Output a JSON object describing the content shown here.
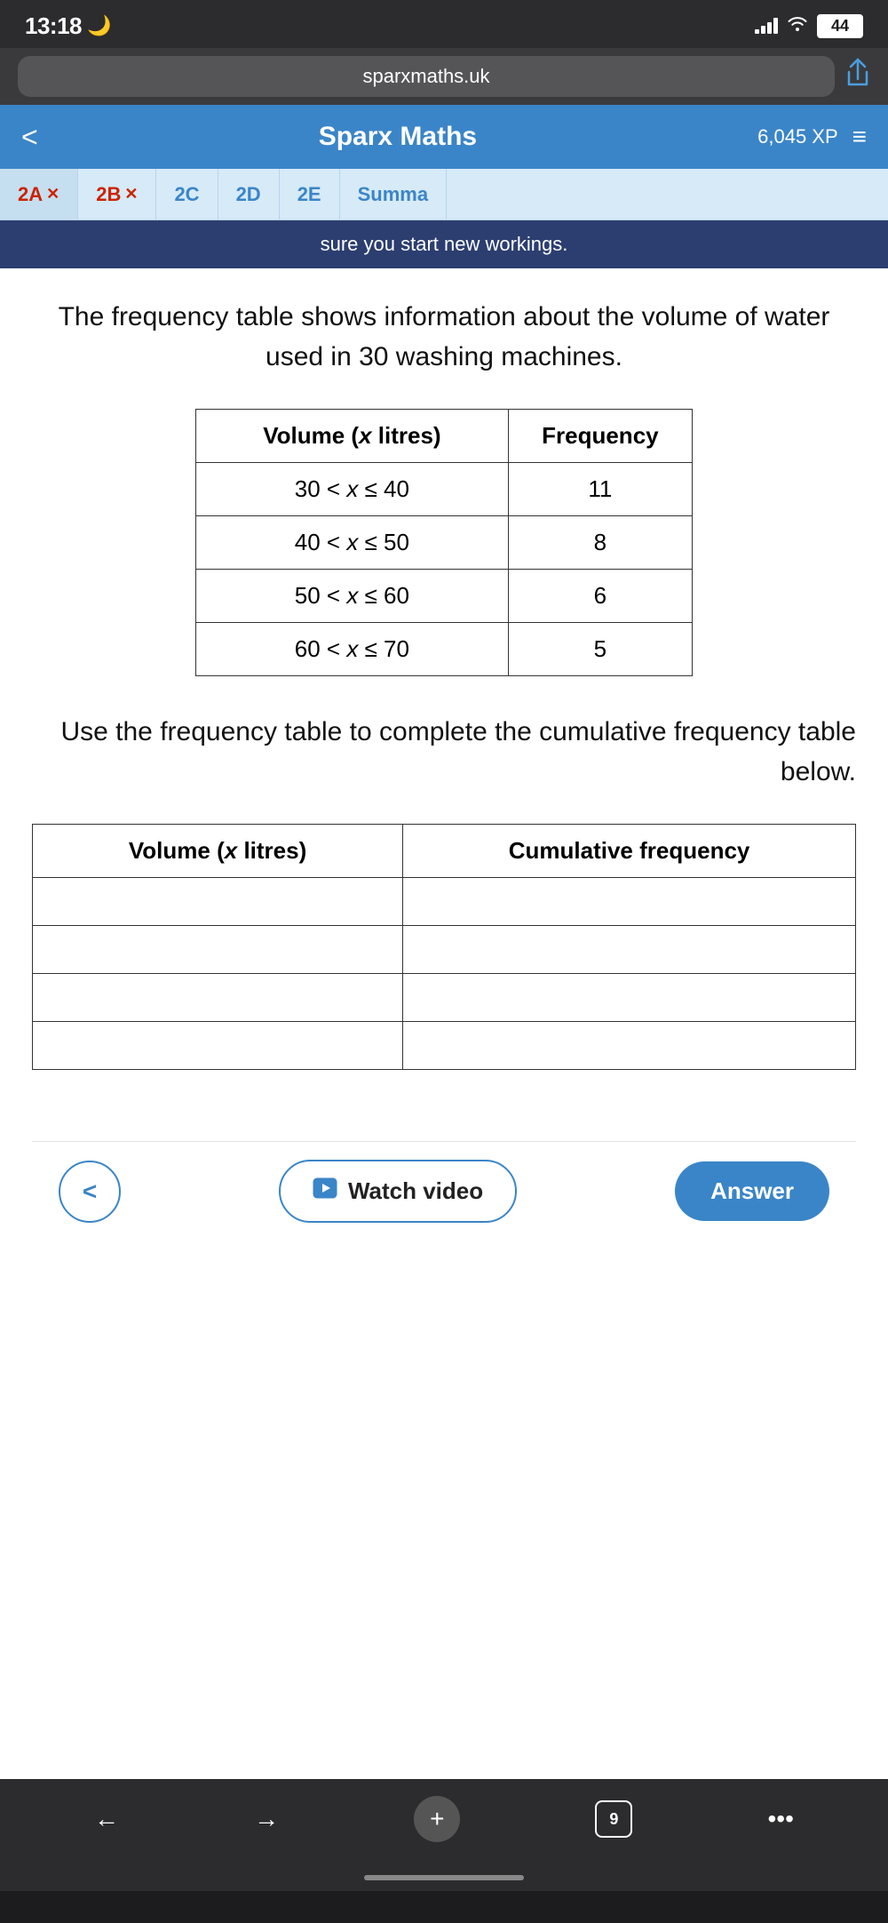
{
  "status_bar": {
    "time": "13:18",
    "moon_icon": "🌙",
    "battery_level": "44",
    "signal_bars": [
      4,
      8,
      12,
      16
    ],
    "wifi": "⌐"
  },
  "browser": {
    "url": "sparxmaths.uk",
    "share_icon": "↑"
  },
  "header": {
    "back_label": "<",
    "title": "Sparx Maths",
    "xp_label": "6,045 XP",
    "menu_icon": "≡"
  },
  "tabs": [
    {
      "id": "2A",
      "label": "2A",
      "has_x": true,
      "state": "error"
    },
    {
      "id": "2B",
      "label": "2B",
      "has_x": true,
      "state": "error"
    },
    {
      "id": "2C",
      "label": "2C",
      "has_x": false,
      "state": "normal"
    },
    {
      "id": "2D",
      "label": "2D",
      "has_x": false,
      "state": "normal"
    },
    {
      "id": "2E",
      "label": "2E",
      "has_x": false,
      "state": "normal"
    },
    {
      "id": "Summa",
      "label": "Summa",
      "has_x": false,
      "state": "normal"
    }
  ],
  "notice": "sure you start new workings.",
  "question": {
    "text": "The frequency table shows information about the volume of water used in 30 washing machines."
  },
  "frequency_table": {
    "headers": [
      "Volume (x litres)",
      "Frequency"
    ],
    "rows": [
      {
        "range": "30 < x ≤ 40",
        "frequency": "11"
      },
      {
        "range": "40 < x ≤ 50",
        "frequency": "8"
      },
      {
        "range": "50 < x ≤ 60",
        "frequency": "6"
      },
      {
        "range": "60 < x ≤ 70",
        "frequency": "5"
      }
    ]
  },
  "instruction": "Use the frequency table to complete the cumulative frequency table below.",
  "cumulative_table": {
    "headers": [
      "Volume (x litres)",
      "Cumulative frequency"
    ],
    "rows": [
      {
        "range": "",
        "cumfreq": ""
      },
      {
        "range": "",
        "cumfreq": ""
      },
      {
        "range": "",
        "cumfreq": ""
      },
      {
        "range": "",
        "cumfreq": ""
      }
    ]
  },
  "actions": {
    "back_label": "<",
    "watch_video_label": "Watch video",
    "video_icon": "▶",
    "answer_label": "Answer"
  },
  "browser_nav": {
    "back_label": "←",
    "forward_label": "→",
    "add_label": "+",
    "tabs_count": "9",
    "more_label": "•••"
  }
}
